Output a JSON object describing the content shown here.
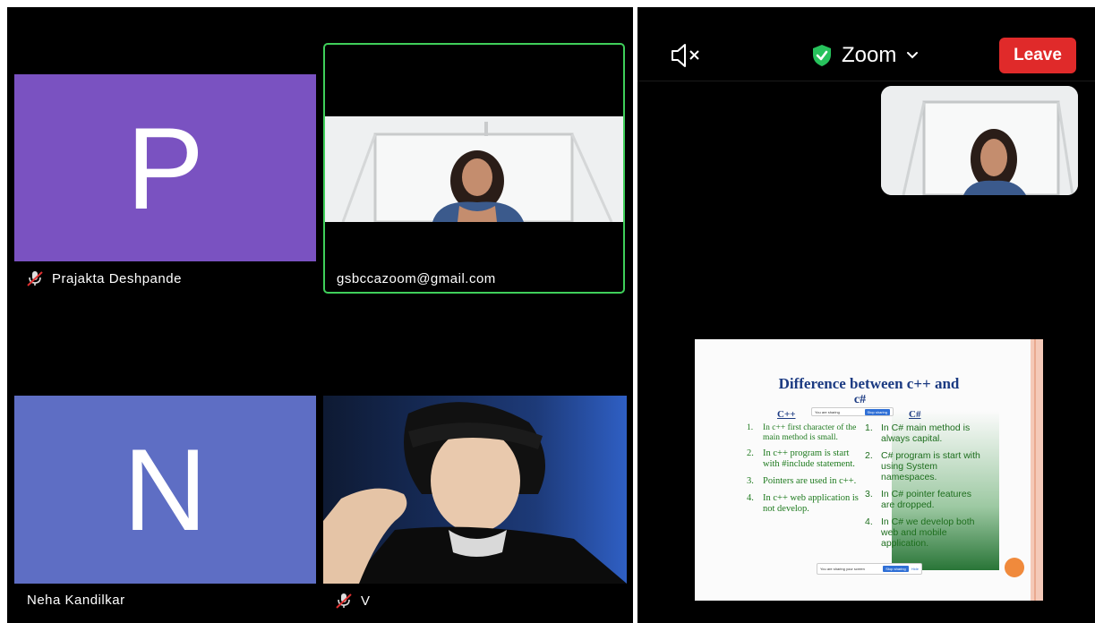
{
  "left_gallery": {
    "participants": [
      {
        "name": "Prajakta Deshpande",
        "initial": "P",
        "muted": true,
        "tile_color": "#7a52c1"
      },
      {
        "name": "gsbccazoom@gmail.com",
        "muted": false,
        "active_speaker": true,
        "highlight_color": "#3fcf5a"
      },
      {
        "name": "Neha Kandilkar",
        "initial": "N",
        "muted": false,
        "tile_color": "#5e6ec4"
      },
      {
        "name": "V",
        "muted": true
      }
    ]
  },
  "right_meeting": {
    "speaker_icon": "speaker-muted-icon",
    "meeting_title": "Zoom",
    "leave_label": "Leave",
    "shield_color": "#27c25c",
    "leave_color": "#e02a2a"
  },
  "slide": {
    "title_line1": "Difference between c++ and",
    "title_line2": "c#",
    "left_heading": "C++",
    "right_heading": "C#",
    "left_items": [
      "In c++ first character of the main method is small.",
      "In c++ program is start with #include statement.",
      "Pointers are used in c++.",
      "In c++ web application is not develop."
    ],
    "right_items": [
      "In C# main method is always capital.",
      "C# program is start with using System namespaces.",
      "In C# pointer features are dropped.",
      "In C# we develop both web and mobile application."
    ],
    "numbers": [
      "1.",
      "2.",
      "3.",
      "4."
    ],
    "share_bar_stop": "Stop sharing",
    "bottom_bar_stop": "Stop sharing"
  }
}
